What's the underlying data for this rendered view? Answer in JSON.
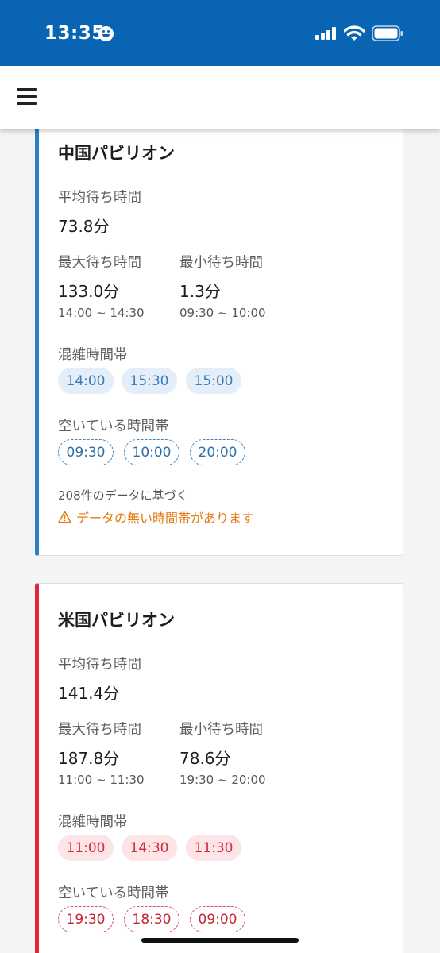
{
  "status_bar": {
    "time": "13:35",
    "icons": [
      "smiley-icon",
      "cellular-signal-icon",
      "wifi-icon",
      "battery-icon"
    ]
  },
  "app_bar": {
    "menu_icon": "hamburger-menu-icon"
  },
  "labels": {
    "avg_wait": "平均待ち時間",
    "max_wait": "最大待ち時間",
    "min_wait": "最小待ち時間",
    "busy_times": "混雑時間帯",
    "free_times": "空いている時間帯"
  },
  "cards": [
    {
      "title": "中国パビリオン",
      "accent": "#2e7ec2",
      "avg": "73.8分",
      "max": "133.0分",
      "max_range": "14:00 ~ 14:30",
      "min": "1.3分",
      "min_range": "09:30 ~ 10:00",
      "busy": [
        "14:00",
        "15:30",
        "15:00"
      ],
      "free": [
        "09:30",
        "10:00",
        "20:00"
      ],
      "note": "208件のデータに基づく",
      "warning": "データの無い時間帯があります",
      "warning_icon": "warning-triangle-icon"
    },
    {
      "title": "米国パビリオン",
      "accent": "#e0283a",
      "avg": "141.4分",
      "max": "187.8分",
      "max_range": "11:00 ~ 11:30",
      "min": "78.6分",
      "min_range": "19:30 ~ 20:00",
      "busy": [
        "11:00",
        "14:30",
        "11:30"
      ],
      "free": [
        "19:30",
        "18:30",
        "09:00"
      ]
    }
  ]
}
